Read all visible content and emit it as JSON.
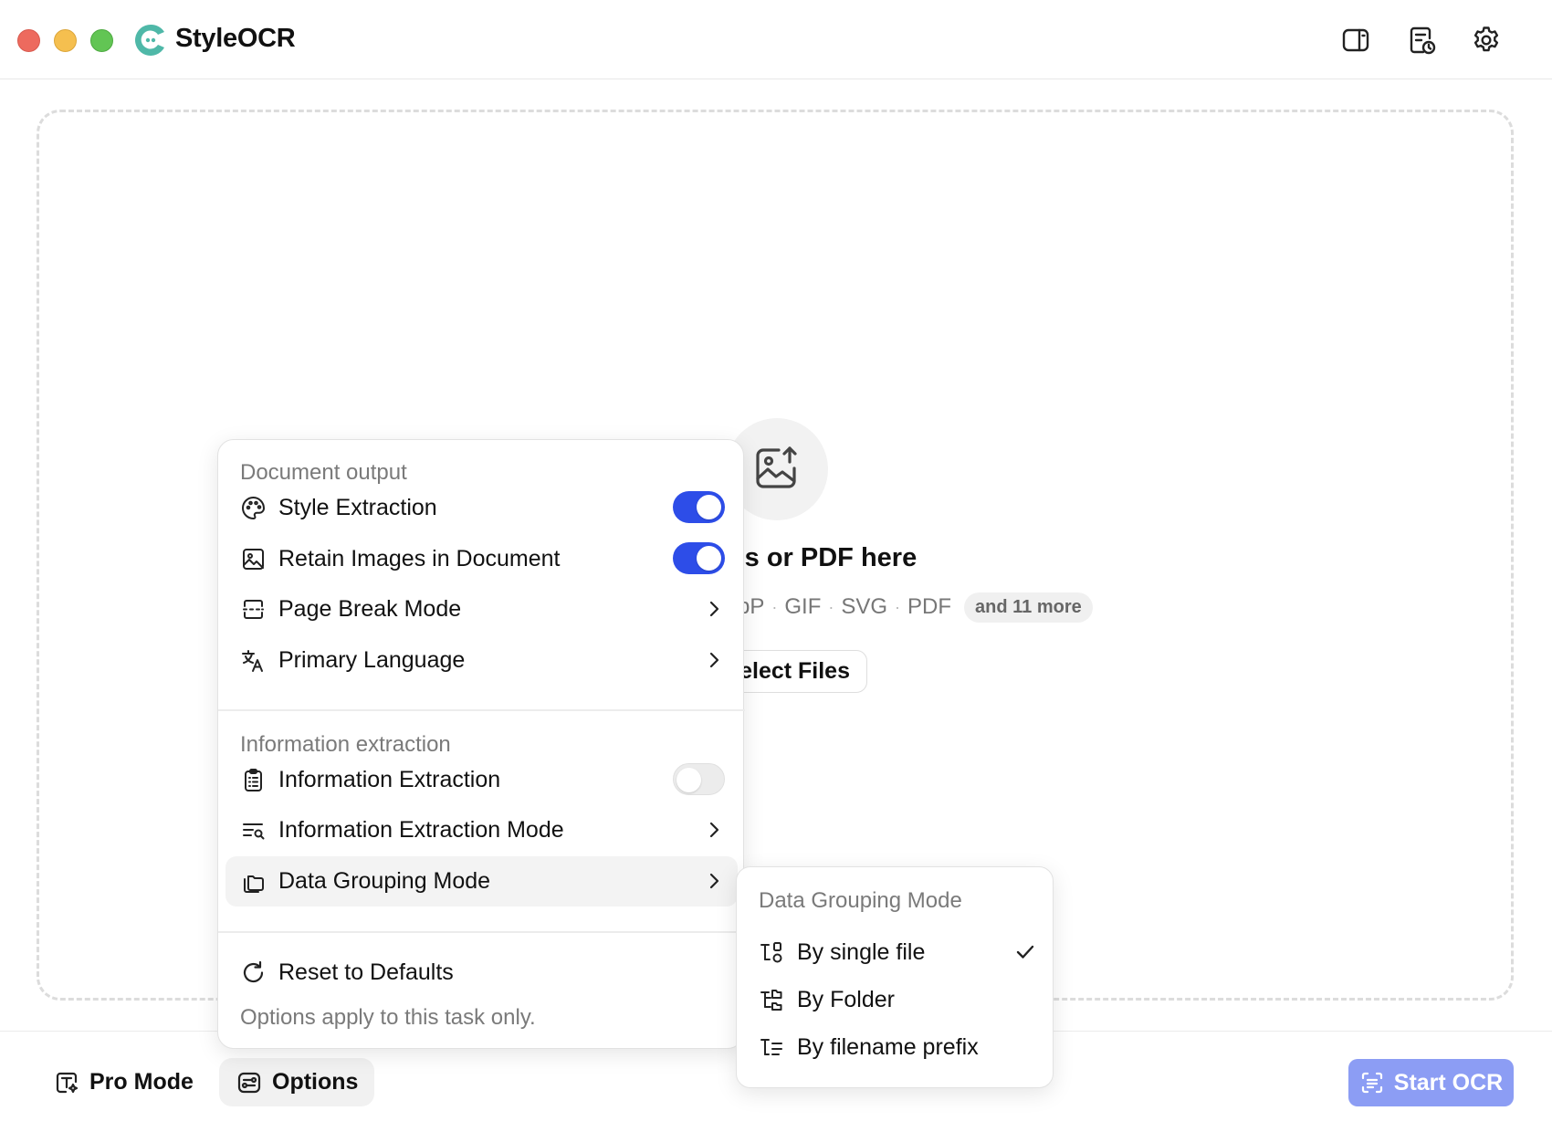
{
  "app": {
    "title": "StyleOCR"
  },
  "colors": {
    "accent": "#2d4de8",
    "start_button": "#8c9df4",
    "logo": "#4fb8a8"
  },
  "header": {
    "icons": [
      "sidebar-toggle-icon",
      "document-history-icon",
      "gear-icon"
    ]
  },
  "dropzone": {
    "title": "ges or PDF here",
    "formats": [
      "bP",
      "GIF",
      "SVG",
      "PDF"
    ],
    "more_badge": "and 11 more",
    "select_button": "elect Files"
  },
  "bottom": {
    "pro_mode": "Pro Mode",
    "options": "Options",
    "start": "Start OCR"
  },
  "options_menu": {
    "section_document": "Document output",
    "style_extraction": {
      "label": "Style Extraction",
      "enabled": true
    },
    "retain_images": {
      "label": "Retain Images in Document",
      "enabled": true
    },
    "page_break_mode": "Page Break Mode",
    "primary_language": "Primary Language",
    "section_information": "Information extraction",
    "information_extraction": {
      "label": "Information Extraction",
      "enabled": false
    },
    "information_extraction_mode": "Information Extraction Mode",
    "data_grouping_mode": "Data Grouping Mode",
    "reset": "Reset to Defaults",
    "footnote": "Options apply to this task only."
  },
  "grouping_submenu": {
    "title": "Data Grouping Mode",
    "options": [
      "By single file",
      "By Folder",
      "By filename prefix"
    ],
    "selected": "By single file"
  }
}
